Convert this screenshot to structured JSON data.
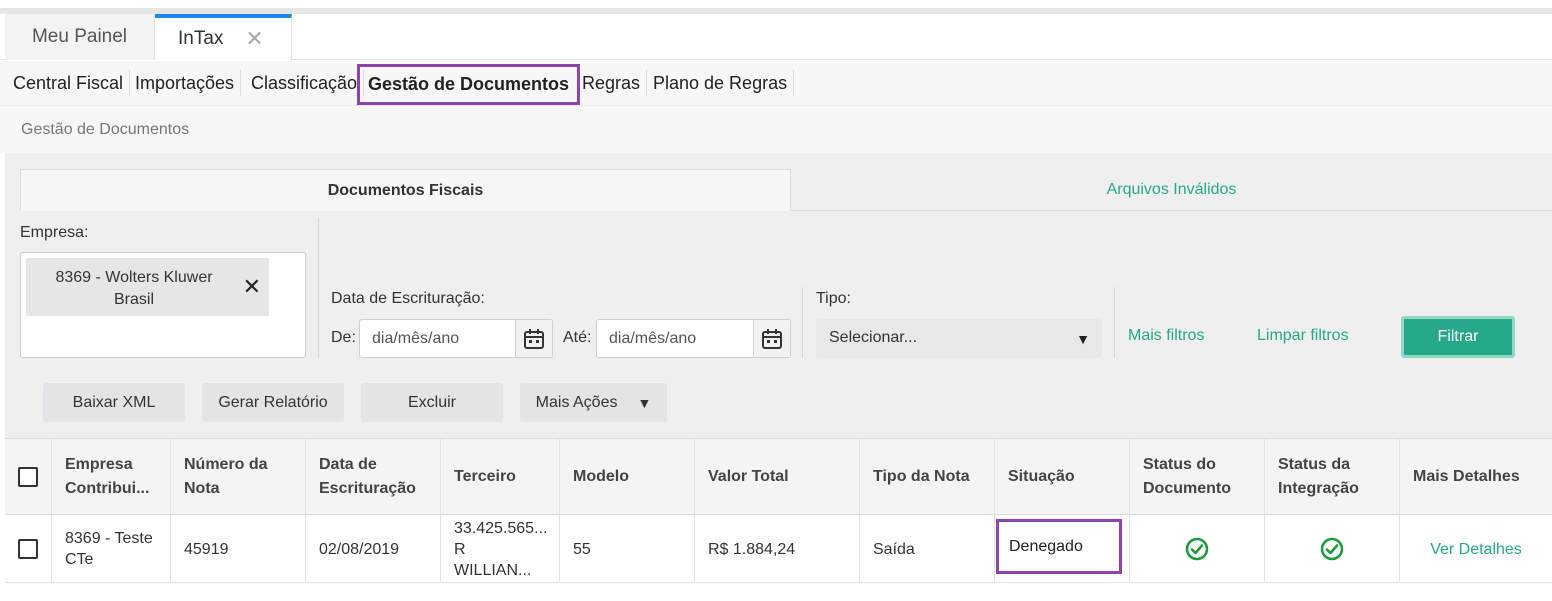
{
  "window_tabs": [
    {
      "label": "Meu Painel"
    },
    {
      "label": "InTax",
      "close": "✕"
    }
  ],
  "menu": {
    "items": [
      "Central Fiscal",
      "Importações",
      "Classificação",
      "Gestão de Documentos",
      "Regras",
      "Plano de Regras"
    ],
    "active": "Gestão de Documentos"
  },
  "breadcrumb": "Gestão de Documentos",
  "doc_tabs": [
    "Documentos Fiscais",
    "Arquivos Inválidos"
  ],
  "filters": {
    "empresa_label": "Empresa:",
    "empresa_chip": "8369 - Wolters Kluwer Brasil",
    "data_label": "Data de Escrituração:",
    "de_label": "De:",
    "ate_label": "Até:",
    "date_placeholder": "dia/mês/ano",
    "tipo_label": "Tipo:",
    "tipo_value": "Selecionar...",
    "mais_filtros": "Mais filtros",
    "limpar_filtros": "Limpar filtros",
    "filtrar": "Filtrar"
  },
  "actions": {
    "baixar_xml": "Baixar XML",
    "gerar_relatorio": "Gerar Relatório",
    "excluir": "Excluir",
    "mais_acoes": "Mais Ações"
  },
  "table": {
    "headers": [
      "Empresa Contribui...",
      "Número da Nota",
      "Data de Escrituração",
      "Terceiro",
      "Modelo",
      "Valor Total",
      "Tipo da Nota",
      "Situação",
      "Status do Documento",
      "Status da Integração",
      "Mais Detalhes"
    ],
    "rows": [
      {
        "empresa": "8369 - Teste CTe",
        "numero": "45919",
        "data": "02/08/2019",
        "terceiro_l1": "33.425.565...",
        "terceiro_l2": "R WILLIAN...",
        "modelo": "55",
        "valor": "R$ 1.884,24",
        "tipo": "Saída",
        "situacao": "Denegado",
        "status_documento": "ok",
        "status_integracao": "ok",
        "detalhes": "Ver Detalhes"
      }
    ]
  },
  "colors": {
    "accent": "#26a98b",
    "highlight": "#8e44ad",
    "tab_active": "#1e88e5"
  }
}
